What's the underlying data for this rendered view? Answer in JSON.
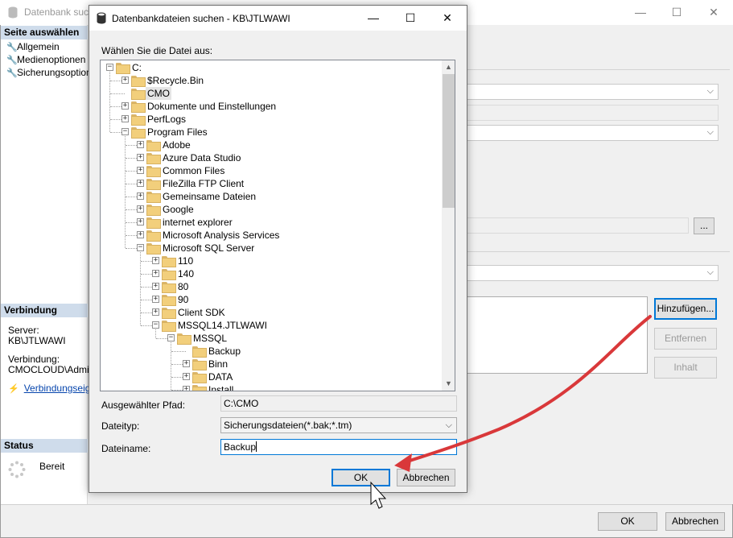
{
  "background_window": {
    "title": "Datenbank such",
    "left_panel": {
      "select_page_header": "Seite auswählen",
      "pages": [
        {
          "label": "Allgemein"
        },
        {
          "label": "Medienoptionen"
        },
        {
          "label": "Sicherungsoptione"
        }
      ],
      "connection_header": "Verbindung",
      "server_label": "Server:",
      "server_value": "KB\\JTLWAWI",
      "connection_label": "Verbindung:",
      "connection_value": "CMOCLOUD\\Adminis",
      "connection_props_link": "Verbindungseige",
      "status_header": "Status",
      "status_value": "Bereit"
    },
    "right_panel": {
      "add_button": "Hinzufügen...",
      "remove_button": "Entfernen",
      "contents_button": "Inhalt",
      "browse_button": "..."
    },
    "ok_button": "OK",
    "cancel_button": "Abbrechen",
    "window_controls": {
      "minimize": "—",
      "maximize": "☐",
      "close": "✕"
    }
  },
  "dialog": {
    "title": "Datenbankdateien suchen - KB\\JTLWAWI",
    "window_controls": {
      "minimize": "—",
      "maximize": "☐",
      "close": "✕"
    },
    "choose_file_label": "Wählen Sie die Datei aus:",
    "tree": [
      {
        "label": "C:",
        "level": 0,
        "expander": "−"
      },
      {
        "label": "$Recycle.Bin",
        "level": 1,
        "expander": "+"
      },
      {
        "label": "CMO",
        "level": 1,
        "expander": "",
        "selected": true
      },
      {
        "label": "Dokumente und Einstellungen",
        "level": 1,
        "expander": "+"
      },
      {
        "label": "PerfLogs",
        "level": 1,
        "expander": "+"
      },
      {
        "label": "Program Files",
        "level": 1,
        "expander": "−"
      },
      {
        "label": "Adobe",
        "level": 2,
        "expander": "+"
      },
      {
        "label": "Azure Data Studio",
        "level": 2,
        "expander": "+"
      },
      {
        "label": "Common Files",
        "level": 2,
        "expander": "+"
      },
      {
        "label": "FileZilla FTP Client",
        "level": 2,
        "expander": "+"
      },
      {
        "label": "Gemeinsame Dateien",
        "level": 2,
        "expander": "+"
      },
      {
        "label": "Google",
        "level": 2,
        "expander": "+"
      },
      {
        "label": "internet explorer",
        "level": 2,
        "expander": "+"
      },
      {
        "label": "Microsoft Analysis Services",
        "level": 2,
        "expander": "+"
      },
      {
        "label": "Microsoft SQL Server",
        "level": 2,
        "expander": "−"
      },
      {
        "label": "110",
        "level": 3,
        "expander": "+"
      },
      {
        "label": "140",
        "level": 3,
        "expander": "+"
      },
      {
        "label": "80",
        "level": 3,
        "expander": "+"
      },
      {
        "label": "90",
        "level": 3,
        "expander": "+"
      },
      {
        "label": "Client SDK",
        "level": 3,
        "expander": "+"
      },
      {
        "label": "MSSQL14.JTLWAWI",
        "level": 3,
        "expander": "−"
      },
      {
        "label": "MSSQL",
        "level": 4,
        "expander": "−"
      },
      {
        "label": "Backup",
        "level": 5,
        "expander": ""
      },
      {
        "label": "Binn",
        "level": 5,
        "expander": "+"
      },
      {
        "label": "DATA",
        "level": 5,
        "expander": "+"
      },
      {
        "label": "Install",
        "level": 5,
        "expander": "+"
      }
    ],
    "selected_path_label": "Ausgewählter Pfad:",
    "selected_path_value": "C:\\CMO",
    "filetype_label": "Dateityp:",
    "filetype_value": "Sicherungsdateien(*.bak;*.tm)",
    "filename_label": "Dateiname:",
    "filename_value": "Backup",
    "ok_button": "OK",
    "cancel_button": "Abbrechen"
  },
  "colors": {
    "annotation_arrow": "#d9383a",
    "accent": "#0078d7",
    "panel_header": "#cfdceb",
    "folder": "#f2cf7c"
  }
}
